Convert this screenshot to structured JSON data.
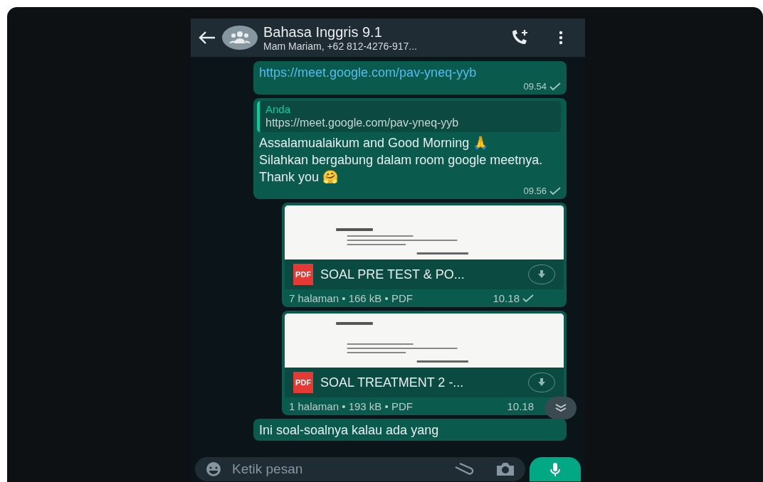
{
  "header": {
    "title": "Bahasa Inggris 9.1",
    "subtitle": "Mam Mariam, +62 812-4276-917..."
  },
  "messages": [
    {
      "kind": "link",
      "text": "https://meet.google.com/pav-yneq-yyb",
      "time": "09.54",
      "sent": true
    },
    {
      "kind": "reply",
      "quote_author": "Anda",
      "quote_text": "https://meet.google.com/pav-yneq-yyb",
      "text": "Assalamualaikum and Good Morning 🙏\nSilahkan bergabung dalam room google meetnya. Thank you 🤗",
      "time": "09.56",
      "sent": true
    },
    {
      "kind": "document",
      "file_type": "PDF",
      "name": "SOAL PRE TEST & PO...",
      "meta": "7 halaman • 166 kB • PDF",
      "time": "10.18",
      "sent": true
    },
    {
      "kind": "document",
      "file_type": "PDF",
      "name": "SOAL TREATMENT 2 -...",
      "meta": "1 halaman • 193 kB • PDF",
      "time": "10.18"
    },
    {
      "kind": "text",
      "text": "Ini soal-soalnya kalau ada yang"
    }
  ],
  "composer": {
    "placeholder": "Ketik pesan"
  }
}
